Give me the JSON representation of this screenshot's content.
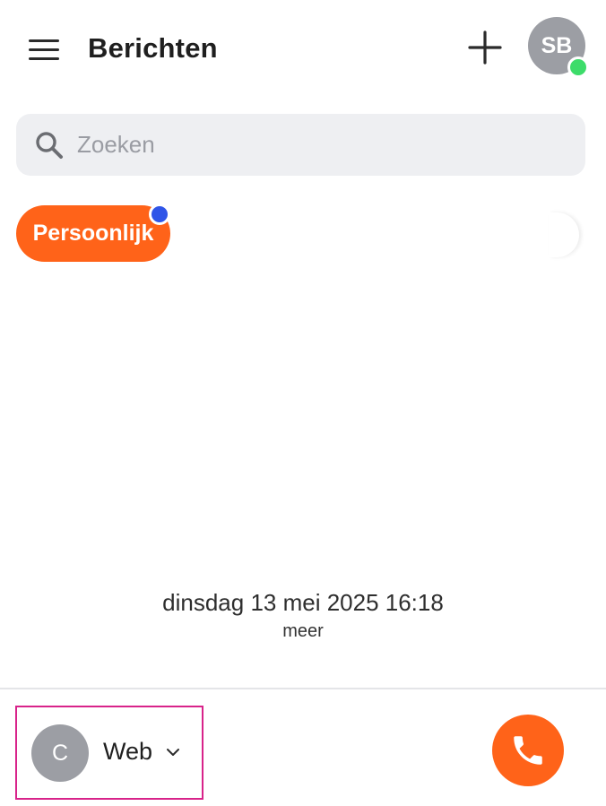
{
  "header": {
    "title": "Berichten",
    "avatar_initials": "SB",
    "presence_color": "#3ddc6a"
  },
  "search": {
    "placeholder": "Zoeken",
    "value": ""
  },
  "chips": [
    {
      "label": "Persoonlijk",
      "selected": true,
      "unread_dot_color": "#2f55e8"
    }
  ],
  "empty_state": {
    "timestamp": "dinsdag 13 mei 2025 16:18",
    "more_label": "meer"
  },
  "footer": {
    "line_avatar_initial": "C",
    "line_label": "Web"
  },
  "colors": {
    "accent": "#ff6319",
    "avatar_gray": "#9c9ea4",
    "search_bg": "#eeeff2",
    "focus_outline": "#d8238a"
  },
  "icons": {
    "menu": "hamburger-menu-icon",
    "add": "plus-icon",
    "search": "magnifier-icon",
    "chevron": "chevron-down-icon",
    "call": "phone-icon"
  }
}
